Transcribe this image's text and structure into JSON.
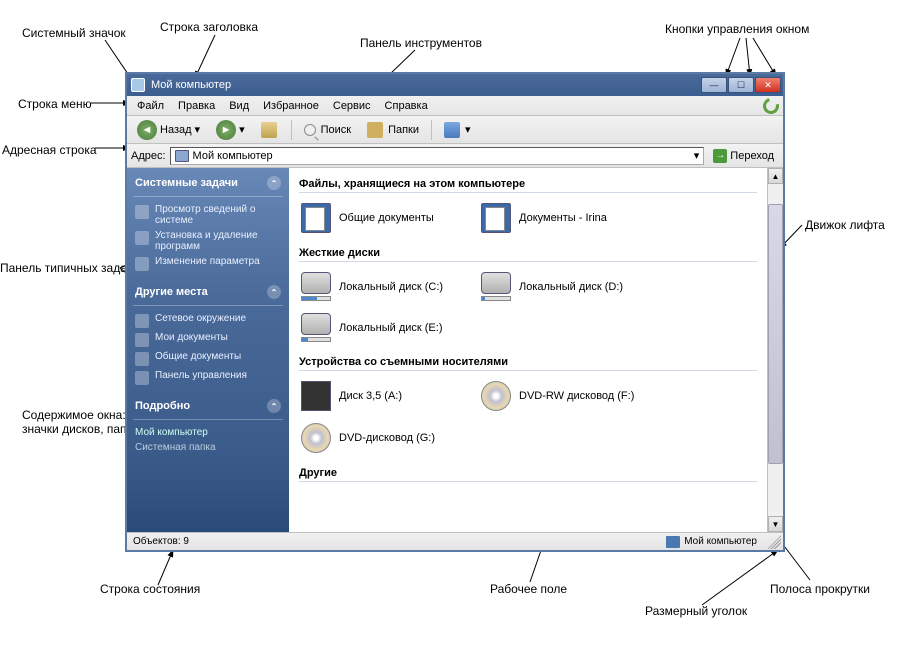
{
  "annotations": {
    "system_icon": "Системный значок",
    "title_row": "Строка заголовка",
    "menu_row": "Строка меню",
    "address_row": "Адресная строка",
    "typical_tasks": "Панель типичных задач",
    "window_content": "Содержимое окна:\nзначки дисков, папок",
    "status_row": "Строка состояния",
    "toolbar_panel": "Панель инструментов",
    "window_buttons": "Кнопки управления окном",
    "scroll_thumb": "Движок лифта",
    "scrollbar": "Полоса прокрутки",
    "resize_corner": "Размерный уголок",
    "work_area": "Рабочее поле"
  },
  "window": {
    "title": "Мой компьютер"
  },
  "menu": {
    "items": [
      "Файл",
      "Правка",
      "Вид",
      "Избранное",
      "Сервис",
      "Справка"
    ]
  },
  "toolbar": {
    "back": "Назад",
    "search": "Поиск",
    "folders": "Папки"
  },
  "address": {
    "label": "Адрес:",
    "value": "Мой компьютер",
    "go": "Переход"
  },
  "sidebar": {
    "groups": [
      {
        "title": "Системные задачи",
        "items": [
          "Просмотр сведений о системе",
          "Установка и удаление программ",
          "Изменение параметра"
        ]
      },
      {
        "title": "Другие места",
        "items": [
          "Сетевое окружение",
          "Мои документы",
          "Общие документы",
          "Панель управления"
        ]
      },
      {
        "title": "Подробно",
        "items": [
          "Мой компьютер",
          "Системная папка"
        ]
      }
    ]
  },
  "content": {
    "sections": [
      {
        "title": "Файлы, хранящиеся на этом компьютере",
        "items": [
          {
            "label": "Общие документы",
            "kind": "docfolder"
          },
          {
            "label": "Документы - Irina",
            "kind": "docfolder"
          }
        ]
      },
      {
        "title": "Жесткие диски",
        "items": [
          {
            "label": "Локальный диск (C:)",
            "kind": "disk",
            "fill": 55
          },
          {
            "label": "Локальный диск (D:)",
            "kind": "disk",
            "fill": 10
          },
          {
            "label": "Локальный диск (E:)",
            "kind": "disk",
            "fill": 20
          }
        ]
      },
      {
        "title": "Устройства со съемными носителями",
        "items": [
          {
            "label": "Диск 3,5 (A:)",
            "kind": "floppy"
          },
          {
            "label": "DVD-RW дисковод (F:)",
            "kind": "dvd"
          },
          {
            "label": "DVD-дисковод (G:)",
            "kind": "dvd"
          }
        ]
      },
      {
        "title": "Другие",
        "items": []
      }
    ]
  },
  "status": {
    "objects": "Объектов: 9",
    "right": "Мой компьютер"
  }
}
